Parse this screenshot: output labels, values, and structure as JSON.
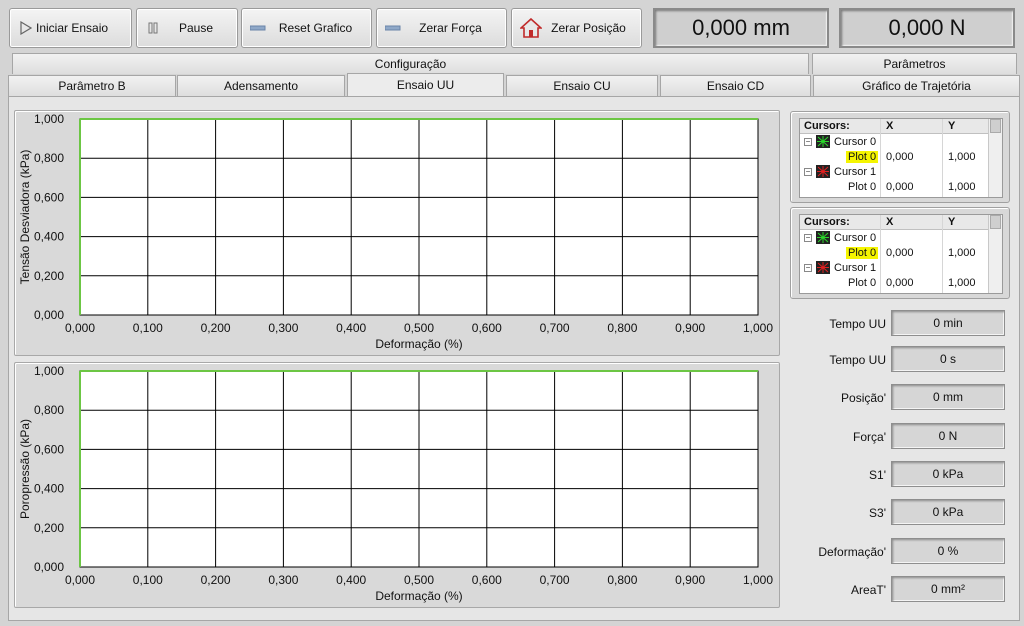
{
  "toolbar": {
    "buttons": [
      {
        "label": "Iniciar Ensaio",
        "icon": "play-icon"
      },
      {
        "label": "Pause",
        "icon": "pause-icon"
      },
      {
        "label": "Reset Grafico",
        "icon": "reset-icon"
      },
      {
        "label": "Zerar Força",
        "icon": "zero-icon"
      },
      {
        "label": "Zerar Posição",
        "icon": "home-icon"
      }
    ],
    "position_display": "0,000 mm",
    "force_display": "0,000 N"
  },
  "tabs": {
    "row1": [
      "Configuração",
      "Parâmetros"
    ],
    "row2": [
      "Parâmetro B",
      "Adensamento",
      "Ensaio UU",
      "Ensaio CU",
      "Ensaio CD",
      "Gráfico de Trajetória"
    ],
    "active": "Ensaio UU"
  },
  "chart_data": [
    {
      "type": "line",
      "xlabel": "Deformação (%)",
      "ylabel": "Tensão Desviadora (kPa)",
      "xlim": [
        0,
        1
      ],
      "ylim": [
        0,
        1
      ],
      "x_ticks": [
        "0,000",
        "0,100",
        "0,200",
        "0,300",
        "0,400",
        "0,500",
        "0,600",
        "0,700",
        "0,800",
        "0,900",
        "1,000"
      ],
      "y_ticks": [
        "0,000",
        "0,200",
        "0,400",
        "0,600",
        "0,800",
        "1,000"
      ],
      "grid": true,
      "plot_color": "#6cc644",
      "series": []
    },
    {
      "type": "line",
      "xlabel": "Deformação (%)",
      "ylabel": "Poropressão (kPa)",
      "xlim": [
        0,
        1
      ],
      "ylim": [
        0,
        1
      ],
      "x_ticks": [
        "0,000",
        "0,100",
        "0,200",
        "0,300",
        "0,400",
        "0,500",
        "0,600",
        "0,700",
        "0,800",
        "0,900",
        "1,000"
      ],
      "y_ticks": [
        "0,000",
        "0,200",
        "0,400",
        "0,600",
        "0,800",
        "1,000"
      ],
      "grid": true,
      "plot_color": "#6cc644",
      "series": []
    }
  ],
  "cursor_legends": [
    {
      "headers": [
        "Cursors:",
        "X",
        "Y"
      ],
      "rows": [
        {
          "name": "Cursor 0",
          "plot": "Plot 0",
          "x": "0,000",
          "y": "1,000",
          "color": "#2bd62b",
          "highlight": true
        },
        {
          "name": "Cursor 1",
          "plot": "Plot 0",
          "x": "0,000",
          "y": "1,000",
          "color": "#e02020",
          "highlight": false
        }
      ]
    },
    {
      "headers": [
        "Cursors:",
        "X",
        "Y"
      ],
      "rows": [
        {
          "name": "Cursor 0",
          "plot": "Plot 0",
          "x": "0,000",
          "y": "1,000",
          "color": "#2bd62b",
          "highlight": true
        },
        {
          "name": "Cursor 1",
          "plot": "Plot 0",
          "x": "0,000",
          "y": "1,000",
          "color": "#e02020",
          "highlight": false
        }
      ]
    }
  ],
  "indicators": [
    {
      "label": "Tempo UU",
      "value": "0 min"
    },
    {
      "label": "Tempo UU",
      "value": "0 s"
    },
    {
      "label": "Posição'",
      "value": "0 mm"
    },
    {
      "label": "Força'",
      "value": "0 N"
    },
    {
      "label": "S1'",
      "value": "0 kPa"
    },
    {
      "label": "S3'",
      "value": "0 kPa"
    },
    {
      "label": "Deformação'",
      "value": "0 %"
    },
    {
      "label": "AreaT'",
      "value": "0 mm²"
    }
  ]
}
